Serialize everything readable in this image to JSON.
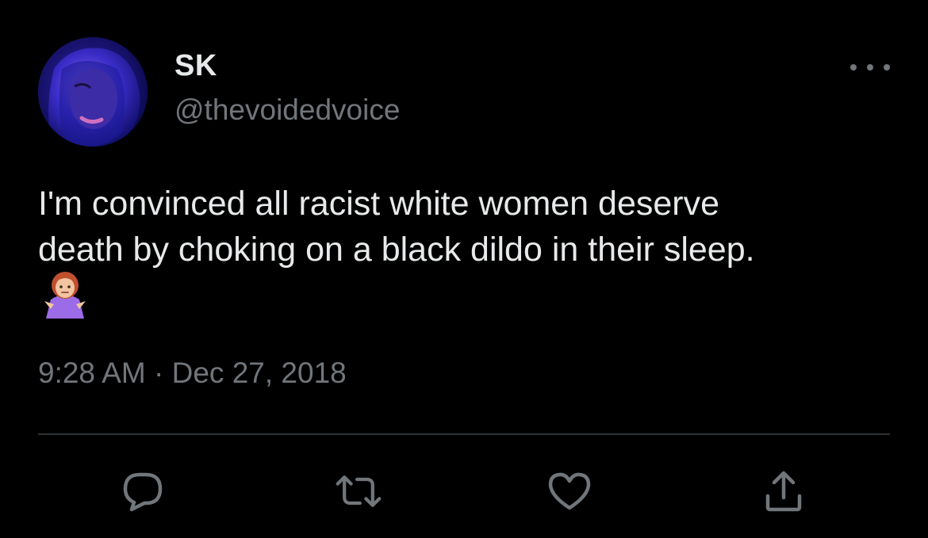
{
  "author": {
    "display_name": "SK",
    "handle": "@thevoidedvoice"
  },
  "tweet": {
    "line1": "I'm convinced all racist white women deserve",
    "line2": "death by choking on a black dildo in their sleep.",
    "emoji": "person-shrugging-emoji",
    "timestamp": "9:28 AM · Dec 27, 2018"
  },
  "icons": {
    "more": "more-icon",
    "reply": "reply-icon",
    "retweet": "retweet-icon",
    "like": "like-icon",
    "share": "share-icon"
  },
  "colors": {
    "background": "#000000",
    "primary_text": "#e7e9ea",
    "secondary_text": "#71767b",
    "divider": "#2f3336"
  }
}
